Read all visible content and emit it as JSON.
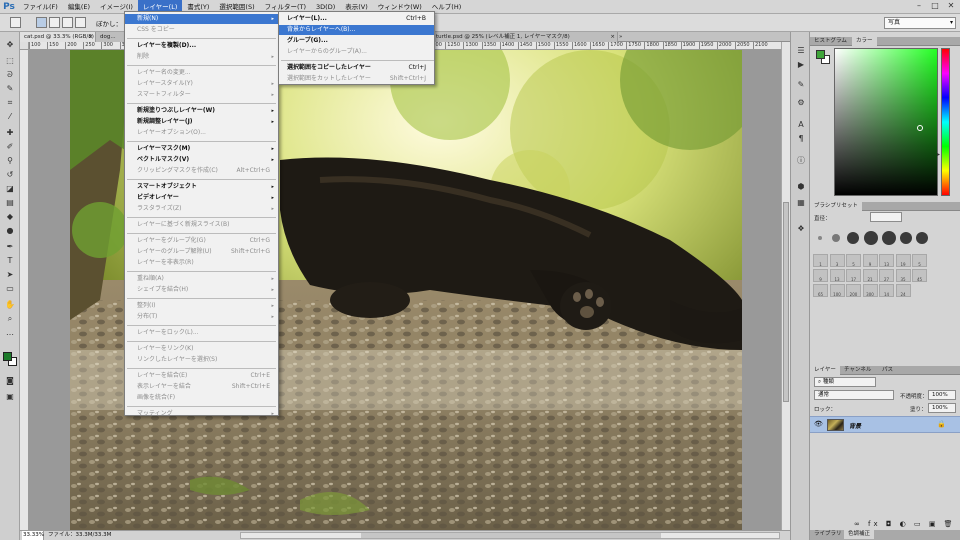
{
  "menubar": {
    "logo": "Ps",
    "items": [
      "ファイル(F)",
      "編集(E)",
      "イメージ(I)",
      "レイヤー(L)",
      "書式(Y)",
      "選択範囲(S)",
      "フィルター(T)",
      "3D(D)",
      "表示(V)",
      "ウィンドウ(W)",
      "ヘルプ(H)"
    ],
    "active_index": 3,
    "window_buttons": [
      "–",
      "□",
      "✕"
    ]
  },
  "options": {
    "label": "ぼかし：",
    "workspace": "写真"
  },
  "doc_tabs": [
    {
      "label": "cat.psd @ 33.3% (RGB/8)",
      "active": true
    },
    {
      "label": "dog...",
      "active": false
    },
    {
      "label": "turtle.psd @ 25% (レベル補正 1, レイヤーマスク/8)",
      "active": false
    }
  ],
  "ruler_ticks": [
    "100",
    "150",
    "200",
    "250",
    "300",
    "350",
    "400",
    "450",
    "500",
    "550",
    "600",
    "650",
    "700",
    "750",
    "800",
    "850",
    "900",
    "950",
    "1000",
    "1050",
    "1100",
    "1150",
    "1200",
    "1250",
    "1300",
    "1350",
    "1400",
    "1450",
    "1500",
    "1550",
    "1600",
    "1650",
    "1700",
    "1750",
    "1800",
    "1850",
    "1900",
    "1950",
    "2000",
    "2050",
    "2100"
  ],
  "status": {
    "zoom": "33.33%",
    "file_info": "ファイル：33.3M/33.3M"
  },
  "menu_layer": {
    "items": [
      {
        "label": "新規(N)",
        "shortcut": "",
        "submenu": true,
        "state": "highlight"
      },
      {
        "label": "CSS をコピー",
        "shortcut": "",
        "submenu": false,
        "state": "disabled"
      },
      {
        "label": "レイヤーを複製(D)...",
        "shortcut": "",
        "submenu": false,
        "state": "bold"
      },
      {
        "label": "削除",
        "shortcut": "",
        "submenu": true,
        "state": "disabled"
      },
      {
        "label": "レイヤー名の変更...",
        "shortcut": "",
        "submenu": false,
        "state": "disabled"
      },
      {
        "label": "レイヤースタイル(Y)",
        "shortcut": "",
        "submenu": true,
        "state": "disabled"
      },
      {
        "label": "スマートフィルター",
        "shortcut": "",
        "submenu": true,
        "state": "disabled"
      },
      {
        "label": "新規塗りつぶしレイヤー(W)",
        "shortcut": "",
        "submenu": true,
        "state": "bold"
      },
      {
        "label": "新規調整レイヤー(J)",
        "shortcut": "",
        "submenu": true,
        "state": "bold"
      },
      {
        "label": "レイヤーオプション(O)...",
        "shortcut": "",
        "submenu": false,
        "state": "disabled"
      },
      {
        "label": "レイヤーマスク(M)",
        "shortcut": "",
        "submenu": true,
        "state": "bold"
      },
      {
        "label": "ベクトルマスク(V)",
        "shortcut": "",
        "submenu": true,
        "state": "bold"
      },
      {
        "label": "クリッピングマスクを作成(C)",
        "shortcut": "Alt+Ctrl+G",
        "submenu": false,
        "state": "disabled"
      },
      {
        "label": "スマートオブジェクト",
        "shortcut": "",
        "submenu": true,
        "state": "bold"
      },
      {
        "label": "ビデオレイヤー",
        "shortcut": "",
        "submenu": true,
        "state": "bold"
      },
      {
        "label": "ラスタライズ(Z)",
        "shortcut": "",
        "submenu": true,
        "state": "disabled"
      },
      {
        "label": "レイヤーに基づく新規スライス(B)",
        "shortcut": "",
        "submenu": false,
        "state": "disabled"
      },
      {
        "label": "レイヤーをグループ化(G)",
        "shortcut": "Ctrl+G",
        "submenu": false,
        "state": "disabled"
      },
      {
        "label": "レイヤーのグループ解除(U)",
        "shortcut": "Shift+Ctrl+G",
        "submenu": false,
        "state": "disabled"
      },
      {
        "label": "レイヤーを非表示(R)",
        "shortcut": "",
        "submenu": false,
        "state": "disabled"
      },
      {
        "label": "重ね順(A)",
        "shortcut": "",
        "submenu": true,
        "state": "disabled"
      },
      {
        "label": "シェイプを結合(H)",
        "shortcut": "",
        "submenu": true,
        "state": "disabled"
      },
      {
        "label": "整列(I)",
        "shortcut": "",
        "submenu": true,
        "state": "disabled"
      },
      {
        "label": "分布(T)",
        "shortcut": "",
        "submenu": true,
        "state": "disabled"
      },
      {
        "label": "レイヤーをロック(L)...",
        "shortcut": "",
        "submenu": false,
        "state": "disabled"
      },
      {
        "label": "レイヤーをリンク(K)",
        "shortcut": "",
        "submenu": false,
        "state": "disabled"
      },
      {
        "label": "リンクしたレイヤーを選択(S)",
        "shortcut": "",
        "submenu": false,
        "state": "disabled"
      },
      {
        "label": "レイヤーを結合(E)",
        "shortcut": "Ctrl+E",
        "submenu": false,
        "state": "disabled"
      },
      {
        "label": "表示レイヤーを結合",
        "shortcut": "Shift+Ctrl+E",
        "submenu": false,
        "state": "disabled"
      },
      {
        "label": "画像を統合(F)",
        "shortcut": "",
        "submenu": false,
        "state": "disabled"
      },
      {
        "label": "マッティング",
        "shortcut": "",
        "submenu": true,
        "state": "disabled"
      }
    ]
  },
  "menu_new": {
    "items": [
      {
        "label": "レイヤー(L)...",
        "shortcut": "Ctrl+B",
        "state": "bold"
      },
      {
        "label": "背景からレイヤーへ(B)...",
        "shortcut": "",
        "state": "highlight"
      },
      {
        "label": "グループ(G)...",
        "shortcut": "",
        "state": "bold"
      },
      {
        "label": "レイヤーからのグループ(A)...",
        "shortcut": "",
        "state": "disabled"
      },
      {
        "label": "選択範囲をコピーしたレイヤー",
        "shortcut": "Ctrl+J",
        "state": "bold"
      },
      {
        "label": "選択範囲をカットしたレイヤー",
        "shortcut": "Shift+Ctrl+J",
        "state": "disabled"
      }
    ]
  },
  "panels": {
    "color_tabs": [
      "ヒストグラム",
      "カラー"
    ],
    "brush_tabs": [
      "ブラシプリセット"
    ],
    "brush_size_label": "直径：",
    "brush_sizes": [
      "1",
      "3",
      "5",
      "9",
      "13",
      "19",
      "5",
      "9",
      "13",
      "17",
      "21",
      "27",
      "35",
      "45",
      "65",
      "100",
      "200",
      "300",
      "14",
      "24"
    ],
    "layers_tabs": [
      "レイヤー",
      "チャンネル",
      "パス"
    ],
    "layers_kind": "種類",
    "blend_mode": "通常",
    "opacity_label": "不透明度：",
    "opacity_value": "100%",
    "lock_label": "ロック：",
    "fill_label": "塗り：",
    "fill_value": "100%",
    "layer_name": "背景",
    "bottom_tabs": [
      "ライブラリ",
      "色調補正"
    ]
  },
  "colors": {
    "accent": "#3b77d0",
    "foreground": "#1c7a2a"
  }
}
